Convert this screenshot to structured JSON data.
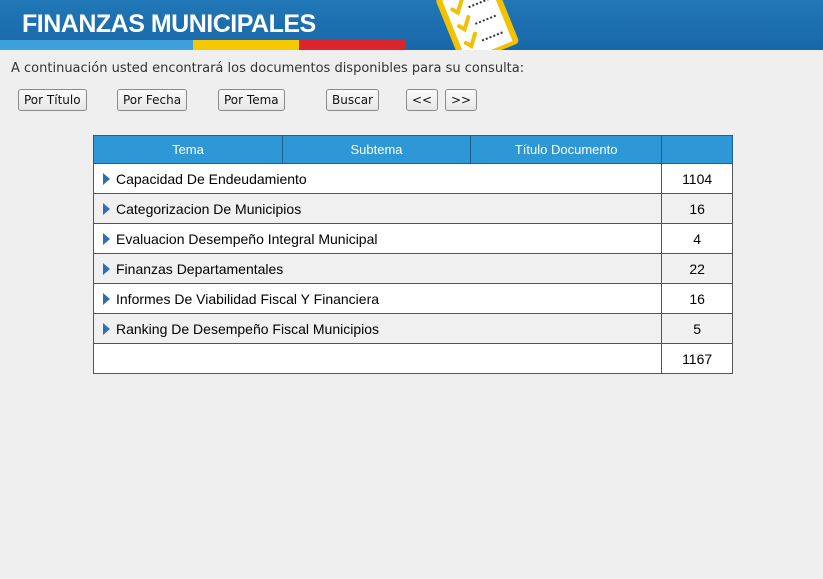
{
  "header": {
    "title": "FINANZAS MUNICIPALES",
    "icon": "checklist-clipboard-icon"
  },
  "intro": "A continuación usted encontrará los documentos disponibles para su consulta:",
  "buttons": {
    "por_titulo": "Por Título",
    "por_fecha": "Por Fecha",
    "por_tema": "Por Tema",
    "buscar": "Buscar",
    "prev": "<<",
    "next": ">>"
  },
  "table": {
    "headers": [
      "Tema",
      "Subtema",
      "Título Documento",
      ""
    ],
    "rows": [
      {
        "name": "Capacidad De Endeudamiento",
        "count": "1104"
      },
      {
        "name": "Categorizacion De Municipios",
        "count": "16"
      },
      {
        "name": "Evaluacion Desempeño Integral Municipal",
        "count": "4"
      },
      {
        "name": "Finanzas Departamentales",
        "count": "22"
      },
      {
        "name": "Informes De Viabilidad Fiscal Y Financiera",
        "count": "16"
      },
      {
        "name": "Ranking De Desempeño Fiscal Municipios",
        "count": "5"
      }
    ],
    "total": {
      "name": "",
      "count": "1167"
    }
  },
  "colors": {
    "header_blue": "#1868a8",
    "stripe_blue": "#3da0dc",
    "stripe_yellow": "#f5c800",
    "stripe_red": "#d9252b",
    "table_header": "#2e98d6",
    "arrow": "#2d6fb8"
  }
}
